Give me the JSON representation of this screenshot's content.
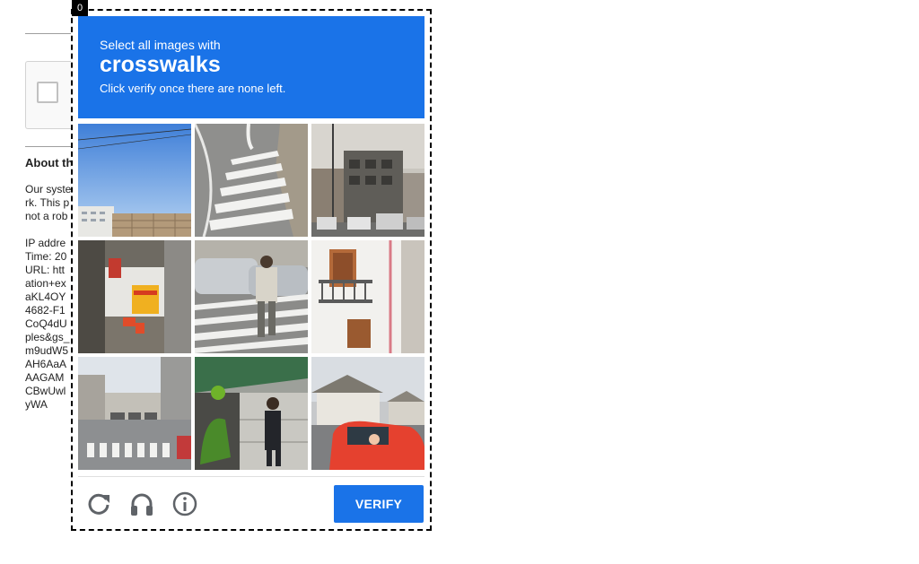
{
  "frame_index": "0",
  "background_page": {
    "about_heading": "About th",
    "body_lines": [
      "Our syste",
      "rk. This p",
      "not a rob"
    ],
    "detail_lines": [
      "IP addre",
      "Time: 20",
      "URL: htt",
      "ation+ex",
      "aKL4OY",
      "4682-F1",
      "CoQ4dU",
      "ples&gs_",
      "m9udW5",
      "AH6AaA",
      "AAGAM",
      "CBwUwl",
      "yWA"
    ]
  },
  "challenge": {
    "instruction": "Select all images with",
    "keyword": "crosswalks",
    "subtext": "Click verify once there are none left.",
    "verify_label": "VERIFY",
    "tiles": [
      {
        "name": "tile-1",
        "scene": "sky-building"
      },
      {
        "name": "tile-2",
        "scene": "crosswalk-road"
      },
      {
        "name": "tile-3",
        "scene": "street-buildings"
      },
      {
        "name": "tile-4",
        "scene": "market-stall"
      },
      {
        "name": "tile-5",
        "scene": "pedestrian-crosswalk"
      },
      {
        "name": "tile-6",
        "scene": "balcony-house"
      },
      {
        "name": "tile-7",
        "scene": "city-crosswalk"
      },
      {
        "name": "tile-8",
        "scene": "scooter-man"
      },
      {
        "name": "tile-9",
        "scene": "red-car-houses"
      }
    ],
    "tools": [
      {
        "name": "reload-icon",
        "label": "reload"
      },
      {
        "name": "audio-icon",
        "label": "audio challenge"
      },
      {
        "name": "info-icon",
        "label": "help"
      }
    ]
  },
  "colors": {
    "accent": "#1a73e8",
    "frame": "#000000"
  }
}
